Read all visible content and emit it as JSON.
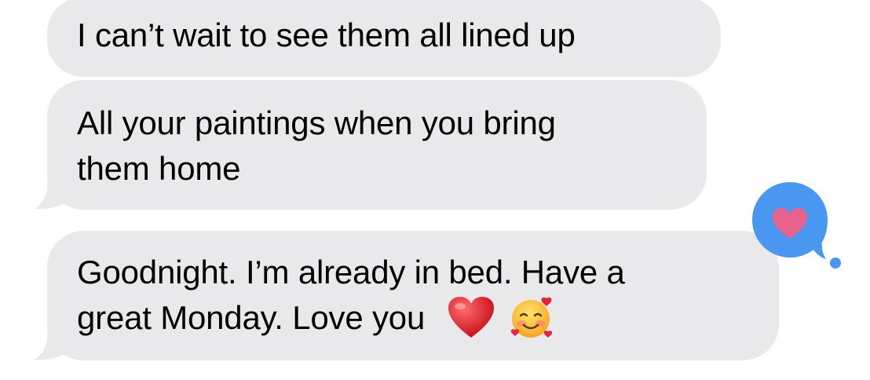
{
  "messages": [
    {
      "lines": [
        "I can’t wait to see them all lined up"
      ]
    },
    {
      "lines": [
        "All your paintings when you bring",
        "them home"
      ]
    },
    {
      "lines": [
        "Goodnight. I’m already in bed. Have a",
        "great Monday. Love you"
      ],
      "trailing_emoji": [
        "red-heart-icon",
        "smiling-face-with-hearts-icon"
      ]
    }
  ],
  "tapback": {
    "icon": "heart-icon",
    "bubble_color": "#4a97f2",
    "heart_color": "#e8638e"
  },
  "colors": {
    "received_bubble": "#e9e9eb",
    "text": "#000000",
    "background": "#ffffff"
  }
}
